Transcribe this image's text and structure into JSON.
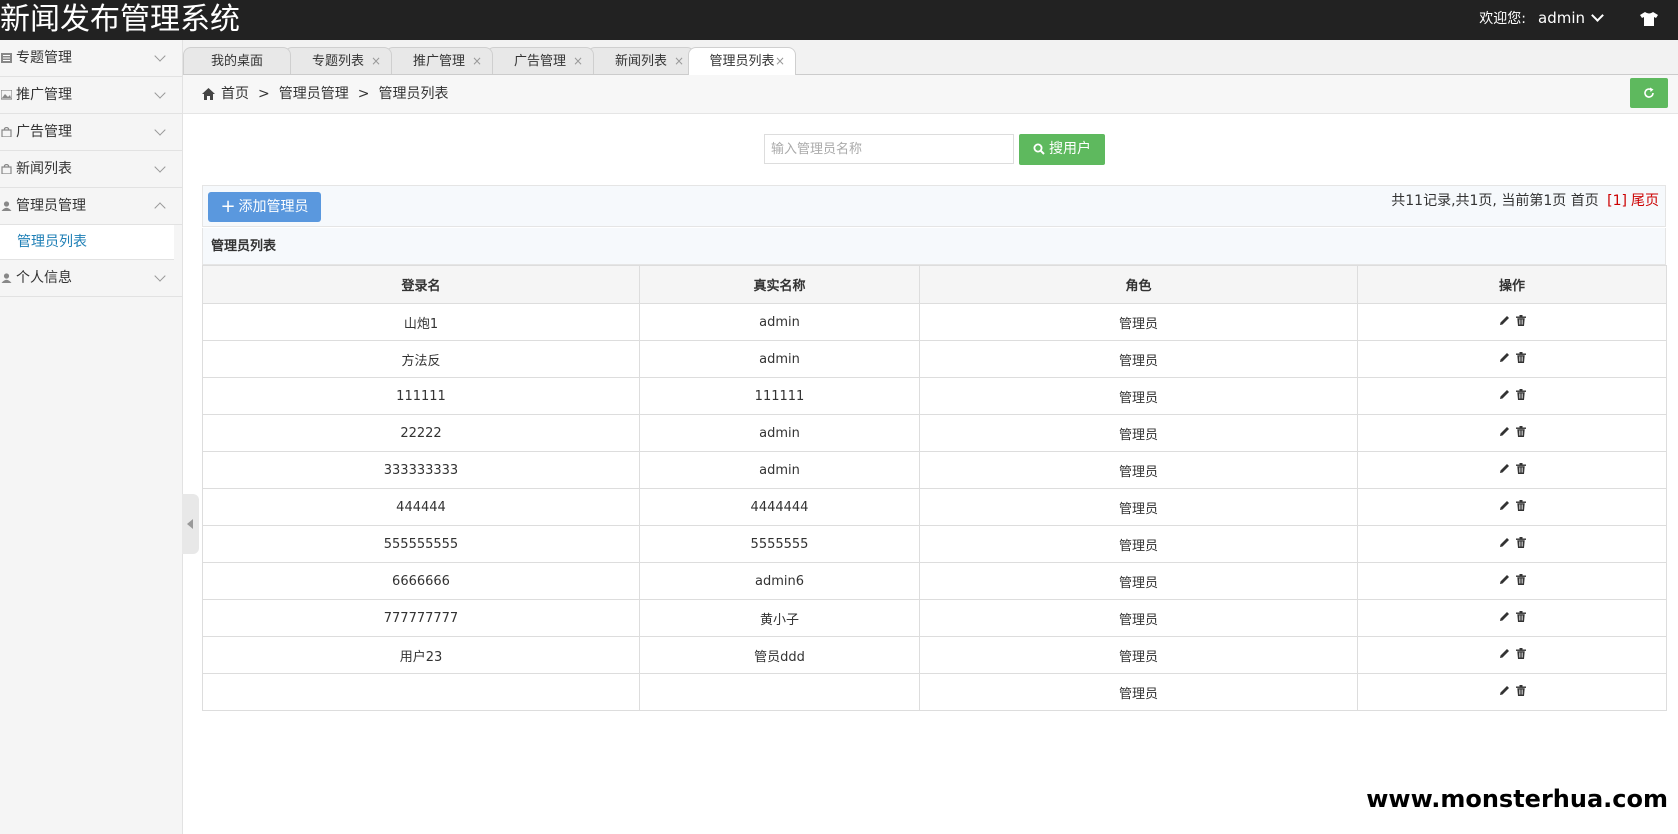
{
  "app": {
    "title": "新闻发布管理系统",
    "welcome": "欢迎您:",
    "username": "admin"
  },
  "sidebar": {
    "items": [
      {
        "label": "专题管理",
        "icon": "list-icon",
        "expanded": false
      },
      {
        "label": "推广管理",
        "icon": "image-icon",
        "expanded": false
      },
      {
        "label": "广告管理",
        "icon": "bag-icon",
        "expanded": false
      },
      {
        "label": "新闻列表",
        "icon": "bag-icon",
        "expanded": false
      },
      {
        "label": "管理员管理",
        "icon": "user-icon",
        "expanded": true,
        "children": [
          {
            "label": "管理员列表",
            "active": true
          }
        ]
      },
      {
        "label": "个人信息",
        "icon": "user-icon",
        "expanded": false
      }
    ]
  },
  "tabs": [
    {
      "label": "我的桌面",
      "closable": false,
      "active": false
    },
    {
      "label": "专题列表",
      "closable": true,
      "active": false
    },
    {
      "label": "推广管理",
      "closable": true,
      "active": false
    },
    {
      "label": "广告管理",
      "closable": true,
      "active": false
    },
    {
      "label": "新闻列表",
      "closable": true,
      "active": false
    },
    {
      "label": "管理员列表",
      "closable": true,
      "active": true
    }
  ],
  "tab_close_glyph": "×",
  "breadcrumb": {
    "items": [
      "首页",
      "管理员管理",
      "管理员列表"
    ],
    "separator": ">"
  },
  "search": {
    "placeholder": "输入管理员名称",
    "value": "",
    "button_label": "搜用户"
  },
  "toolbar": {
    "add_plus": "+",
    "add_label": "添加管理员",
    "pager_text": "共11记录,共1页, 当前第1页 首页",
    "pager_current": "[1]",
    "pager_last": "尾页"
  },
  "table": {
    "caption": "管理员列表",
    "columns": [
      "登录名",
      "真实名称",
      "角色",
      "操作"
    ],
    "rows": [
      {
        "login": "山炮1",
        "realname": "admin",
        "role": "管理员"
      },
      {
        "login": "方法反",
        "realname": "admin",
        "role": "管理员"
      },
      {
        "login": "111111",
        "realname": "111111",
        "role": "管理员"
      },
      {
        "login": "22222",
        "realname": "admin",
        "role": "管理员"
      },
      {
        "login": "333333333",
        "realname": "admin",
        "role": "管理员"
      },
      {
        "login": "444444",
        "realname": "4444444",
        "role": "管理员"
      },
      {
        "login": "555555555",
        "realname": "5555555",
        "role": "管理员"
      },
      {
        "login": "6666666",
        "realname": "admin6",
        "role": "管理员"
      },
      {
        "login": "777777777",
        "realname": "黄小子",
        "role": "管理员"
      },
      {
        "login": "用户23",
        "realname": "管员ddd",
        "role": "管理员"
      },
      {
        "login": "",
        "realname": "",
        "role": "管理员"
      }
    ]
  },
  "colors": {
    "header_bg": "#222222",
    "accent_green": "#5eb95e",
    "accent_blue": "#5a98de",
    "link_blue": "#1e7fb6",
    "pager_red": "#cc0000"
  },
  "watermark": "www.monsterhua.com"
}
